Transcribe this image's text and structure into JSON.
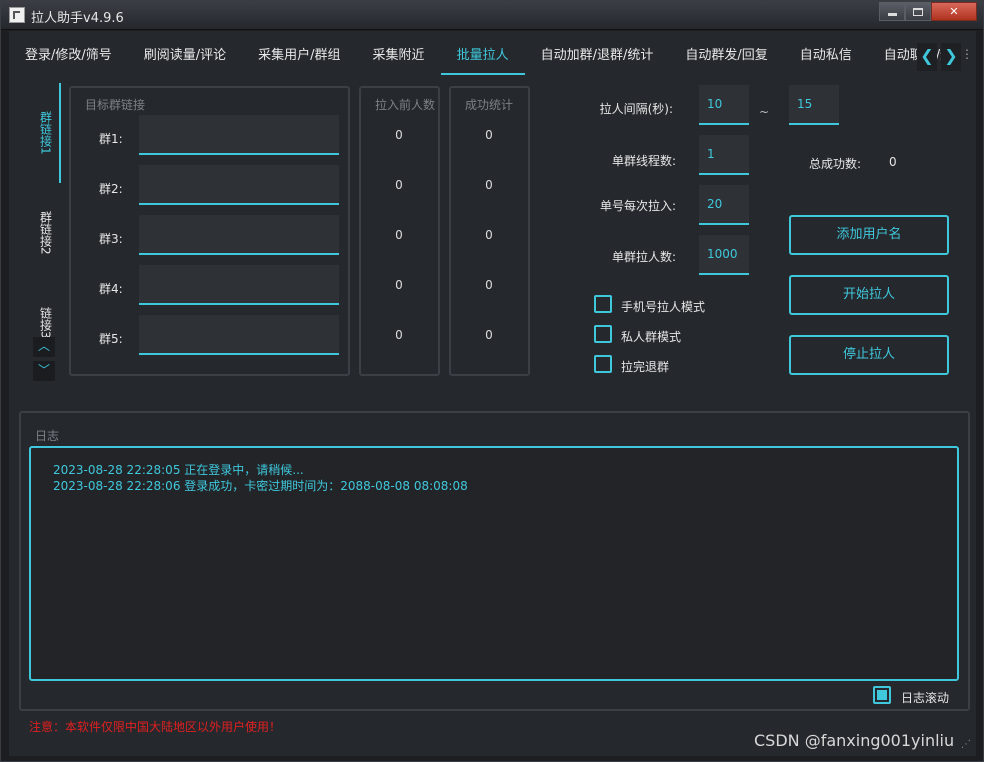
{
  "window": {
    "title": "拉人助手v4.9.6"
  },
  "tabs": [
    {
      "label": "登录/修改/筛号"
    },
    {
      "label": "刷阅读量/评论"
    },
    {
      "label": "采集用户/群组"
    },
    {
      "label": "采集附近"
    },
    {
      "label": "批量拉人"
    },
    {
      "label": "自动加群/退群/统计"
    },
    {
      "label": "自动群发/回复"
    },
    {
      "label": "自动私信"
    },
    {
      "label": "自动聊天/炒"
    }
  ],
  "tab_nav": {
    "prev": "❮",
    "next": "❯",
    "more": "⋮"
  },
  "side_tabs": [
    {
      "label": "群链接1"
    },
    {
      "label": "群链接2"
    },
    {
      "label": "链接3"
    }
  ],
  "side_nav": {
    "up": "︿",
    "down": "﹀"
  },
  "groups_box": {
    "title": "目标群链接",
    "rows": [
      {
        "label": "群1:",
        "value": "",
        "before": "0",
        "success": "0"
      },
      {
        "label": "群2:",
        "value": "",
        "before": "0",
        "success": "0"
      },
      {
        "label": "群3:",
        "value": "",
        "before": "0",
        "success": "0"
      },
      {
        "label": "群4:",
        "value": "",
        "before": "0",
        "success": "0"
      },
      {
        "label": "群5:",
        "value": "",
        "before": "0",
        "success": "0"
      }
    ]
  },
  "before_box": {
    "title": "拉入前人数"
  },
  "success_box": {
    "title": "成功统计"
  },
  "settings": {
    "interval_label": "拉人间隔(秒):",
    "interval_min": "10",
    "interval_sep": "~",
    "interval_max": "15",
    "threads_label": "单群线程数:",
    "threads": "1",
    "per_account_label": "单号每次拉入:",
    "per_account": "20",
    "per_group_label": "单群拉人数:",
    "per_group": "1000",
    "total_label": "总成功数:",
    "total": "0"
  },
  "options": [
    {
      "label": "手机号拉人模式",
      "checked": false
    },
    {
      "label": "私人群模式",
      "checked": false
    },
    {
      "label": "拉完退群",
      "checked": false
    }
  ],
  "buttons": {
    "add_username": "添加用户名",
    "start": "开始拉人",
    "stop": "停止拉人"
  },
  "log": {
    "title": "日志",
    "lines": [
      "2023-08-28 22:28:05 正在登录中，请稍候...",
      "2023-08-28 22:28:06 登录成功，卡密过期时间为：2088-08-08 08:08:08"
    ],
    "autoscroll_label": "日志滚动",
    "autoscroll": true
  },
  "footer": {
    "warning": "注意：本软件仅限中国大陆地区以外用户使用！",
    "watermark": "CSDN @fanxing001yinliu"
  },
  "colors": {
    "accent": "#3fc8dc",
    "background": "#25282d",
    "warning": "#e02020"
  }
}
